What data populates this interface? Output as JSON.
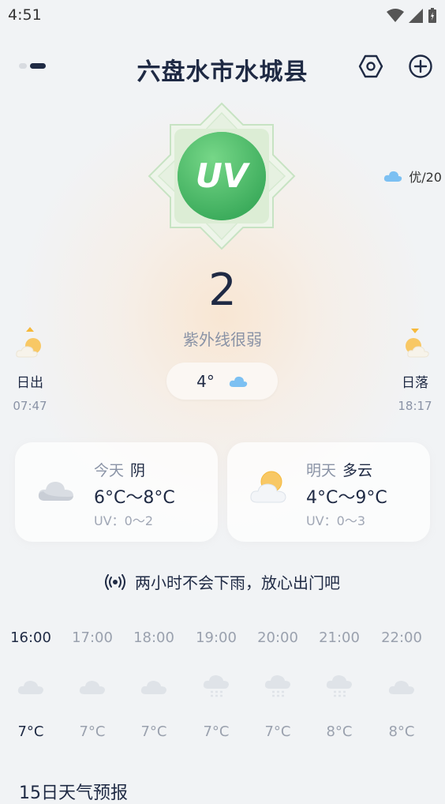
{
  "status_bar": {
    "time": "4:51"
  },
  "header": {
    "city": "六盘水市水城县",
    "page_count": 2,
    "active_page": 2
  },
  "uv": {
    "badge_label": "UV",
    "value": "2",
    "description": "紫外线很弱"
  },
  "air_quality": {
    "label": "优/20",
    "icon": "cloud-icon"
  },
  "current": {
    "temp": "4°",
    "icon": "cloud-icon"
  },
  "sunrise": {
    "label": "日出",
    "time": "07:47",
    "icon": "sunrise-icon"
  },
  "sunset": {
    "label": "日落",
    "time": "18:17",
    "icon": "sunset-icon"
  },
  "cards": [
    {
      "day": "今天",
      "condition": "阴",
      "range": "6°C～8°C",
      "uv": "UV：0～2",
      "icon": "overcast-cloud-icon"
    },
    {
      "day": "明天",
      "condition": "多云",
      "range": "4°C～9°C",
      "uv": "UV：0～3",
      "icon": "partly-cloudy-icon"
    }
  ],
  "rain_notice": "两小时不会下雨，放心出门吧",
  "hourly": [
    {
      "time": "16:00",
      "temp": "7°C",
      "icon": "cloud-icon"
    },
    {
      "time": "17:00",
      "temp": "7°C",
      "icon": "cloud-icon"
    },
    {
      "time": "18:00",
      "temp": "7°C",
      "icon": "cloud-icon"
    },
    {
      "time": "19:00",
      "temp": "7°C",
      "icon": "snow-cloud-icon"
    },
    {
      "time": "20:00",
      "temp": "7°C",
      "icon": "snow-cloud-icon"
    },
    {
      "time": "21:00",
      "temp": "8°C",
      "icon": "snow-cloud-icon"
    },
    {
      "time": "22:00",
      "temp": "8°C",
      "icon": "cloud-icon"
    }
  ],
  "forecast_title": "15日天气预报",
  "colors": {
    "accent": "#1f2a44",
    "uv_green": "#4cc36a",
    "muted": "#8a93a6",
    "sun": "#f6b93b",
    "cloud_blue": "#6fb6f0"
  }
}
